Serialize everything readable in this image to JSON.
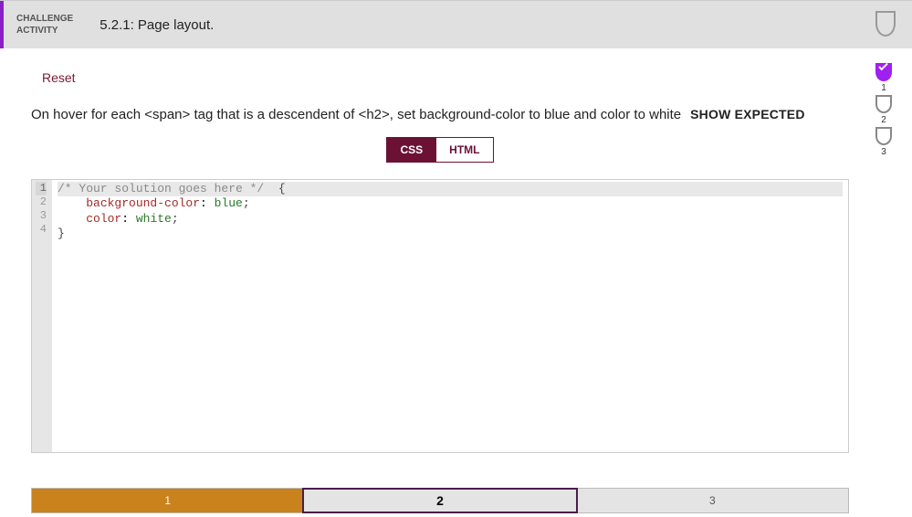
{
  "header": {
    "badge_line1": "CHALLENGE",
    "badge_line2": "ACTIVITY",
    "title": "5.2.1: Page layout."
  },
  "reset_label": "Reset",
  "prompt_text": "On hover for each <span> tag that is a descendent of <h2>, set background-color to blue and color to white",
  "show_expected_label": "SHOW EXPECTED",
  "tabs": {
    "css": "CSS",
    "html": "HTML"
  },
  "code": {
    "lines": [
      "1",
      "2",
      "3",
      "4"
    ],
    "l1_comment": "/* Your solution goes here */",
    "l1_brace": "  {",
    "l2_indent": "    ",
    "l2_prop": "background-color",
    "l2_colon": ": ",
    "l2_val": "blue",
    "l2_semi": ";",
    "l3_indent": "    ",
    "l3_prop": "color",
    "l3_colon": ": ",
    "l3_val": "white",
    "l3_semi": ";",
    "l4": "}"
  },
  "steps": {
    "s1": "1",
    "s2": "2",
    "s3": "3"
  },
  "side": {
    "n1": "1",
    "n2": "2",
    "n3": "3"
  }
}
